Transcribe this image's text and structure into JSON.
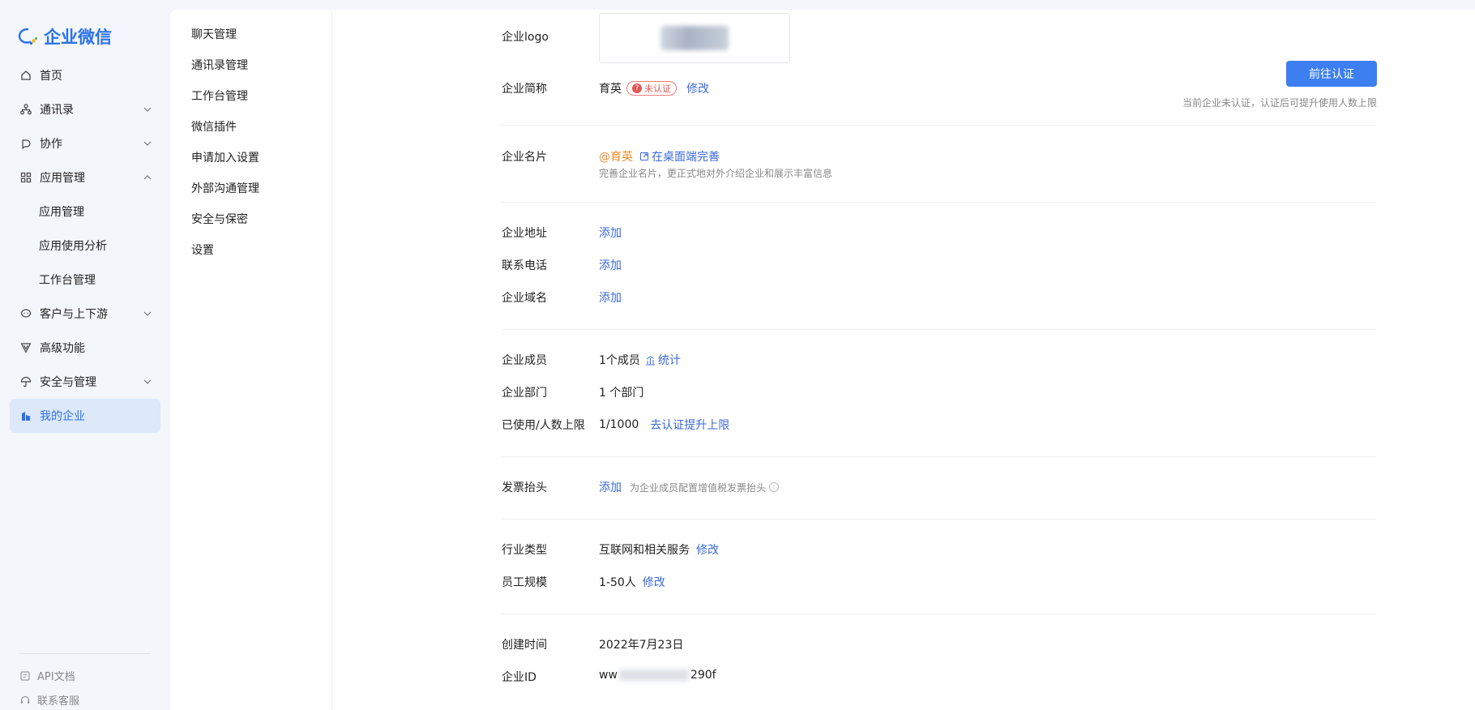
{
  "brand": {
    "name": "企业微信"
  },
  "nav": {
    "home": "首页",
    "contacts": "通讯录",
    "collab": "协作",
    "apps": "应用管理",
    "apps_sub": [
      "应用管理",
      "应用使用分析",
      "工作台管理"
    ],
    "customers": "客户与上下游",
    "advanced": "高级功能",
    "security": "安全与管理",
    "my_company": "我的企业"
  },
  "footer": {
    "api": "API文档",
    "support": "联系客服"
  },
  "submenu": [
    "聊天管理",
    "通讯录管理",
    "工作台管理",
    "微信插件",
    "申请加入设置",
    "外部沟通管理",
    "安全与保密",
    "设置"
  ],
  "info": {
    "logo_label": "企业logo",
    "short_name_label": "企业简称",
    "short_name": "育英",
    "unverified": "未认证",
    "edit": "修改",
    "verify_button": "前往认证",
    "verify_hint": "当前企业未认证，认证后可提升使用人数上限",
    "card_label": "企业名片",
    "card_at": "@育英",
    "card_link": "在桌面端完善",
    "card_desc": "完善企业名片，更正式地对外介绍企业和展示丰富信息",
    "address_label": "企业地址",
    "phone_label": "联系电话",
    "domain_label": "企业域名",
    "add": "添加",
    "members_label": "企业成员",
    "members_value": "1个成员",
    "stats_link": "统计",
    "dept_label": "企业部门",
    "dept_value": "1 个部门",
    "limit_label": "已使用/人数上限",
    "limit_value": "1/1000",
    "limit_link": "去认证提升上限",
    "invoice_label": "发票抬头",
    "invoice_desc": "为企业成员配置增值税发票抬头",
    "industry_label": "行业类型",
    "industry_value": "互联网和相关服务",
    "scale_label": "员工规模",
    "scale_value": "1-50人",
    "created_label": "创建时间",
    "created_value": "2022年7月23日",
    "id_label": "企业ID",
    "id_prefix": "ww",
    "id_suffix": "290f"
  },
  "colors": {
    "accent": "#2b72e6",
    "link": "#3a6ad4",
    "button": "#3d7ff0",
    "warning": "#e45656",
    "orange": "#ef8b2b"
  }
}
